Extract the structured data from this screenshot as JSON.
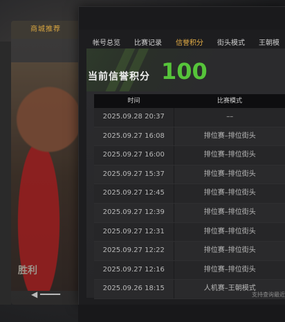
{
  "background": {
    "panel_tab_label": "商城推荐",
    "caption_text": "胜利",
    "arrow_text": "◀  ━━━━"
  },
  "dialog": {
    "tabs": [
      {
        "label": "帐号总览",
        "active": false
      },
      {
        "label": "比赛记录",
        "active": false
      },
      {
        "label": "信誉积分",
        "active": true
      },
      {
        "label": "街头模式",
        "active": false
      },
      {
        "label": "王朝模",
        "active": false
      }
    ],
    "hero": {
      "title": "当前信誉积分",
      "score": "100"
    },
    "table": {
      "headers": {
        "time": "时间",
        "mode": "比赛模式"
      },
      "rows": [
        {
          "time": "2025.09.28  20:37",
          "mode": "––"
        },
        {
          "time": "2025.09.27  16:08",
          "mode": "排位赛–排位街头"
        },
        {
          "time": "2025.09.27  16:00",
          "mode": "排位赛–排位街头"
        },
        {
          "time": "2025.09.27  15:37",
          "mode": "排位赛–排位街头"
        },
        {
          "time": "2025.09.27  12:45",
          "mode": "排位赛–排位街头"
        },
        {
          "time": "2025.09.27  12:39",
          "mode": "排位赛–排位街头"
        },
        {
          "time": "2025.09.27  12:31",
          "mode": "排位赛–排位街头"
        },
        {
          "time": "2025.09.27  12:22",
          "mode": "排位赛–排位街头"
        },
        {
          "time": "2025.09.27  12:16",
          "mode": "排位赛–排位街头"
        },
        {
          "time": "2025.09.26  18:15",
          "mode": "人机赛–王朝模式"
        }
      ]
    },
    "footer_note": "支持查询最近"
  },
  "colors": {
    "accent": "#e8b046",
    "score": "#56c43a"
  }
}
